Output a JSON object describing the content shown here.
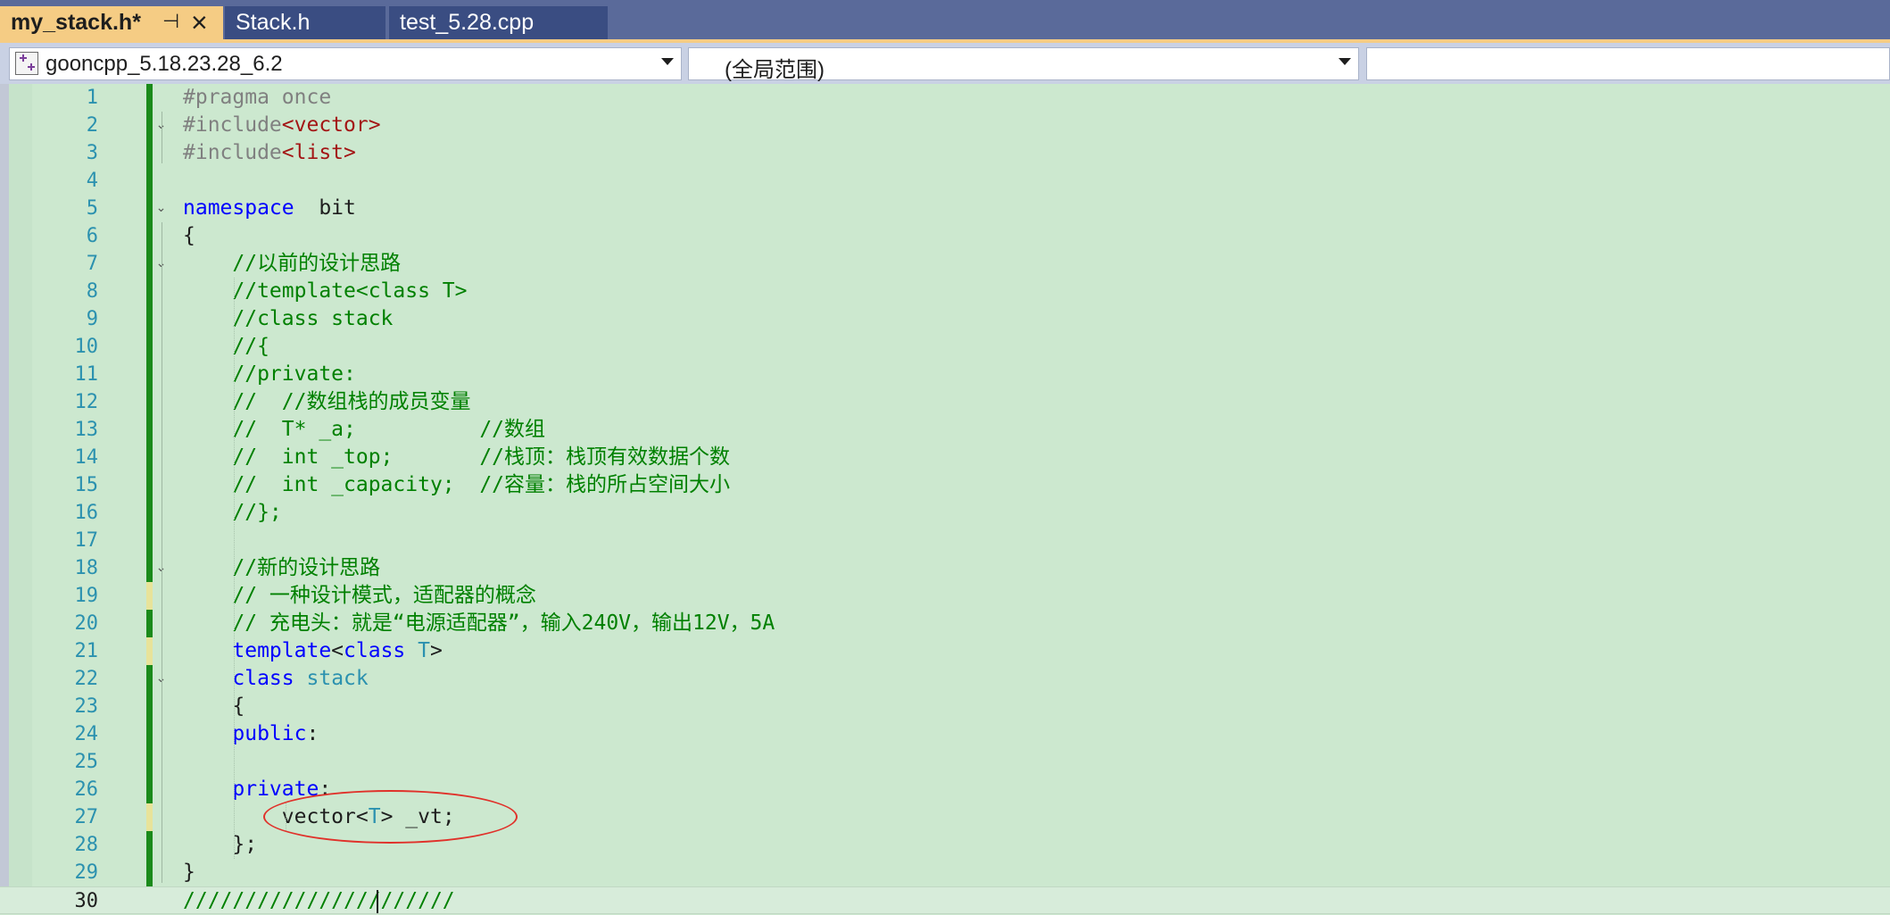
{
  "tabs": [
    {
      "label": "my_stack.h*",
      "active": true,
      "pin_icon": "pin-icon",
      "close_icon": "close-icon"
    },
    {
      "label": "Stack.h",
      "active": false
    },
    {
      "label": "test_5.28.cpp",
      "active": false
    }
  ],
  "navbar": {
    "project": "gooncpp_5.18.23.28_6.2",
    "scope": "(全局范围)",
    "member": ""
  },
  "editor": {
    "current_line": 30,
    "lines": [
      {
        "n": "1",
        "t": [
          [
            "pp",
            "#pragma once"
          ]
        ]
      },
      {
        "n": "2",
        "t": [
          [
            "pp",
            "#include"
          ],
          [
            "str",
            "<vector>"
          ]
        ]
      },
      {
        "n": "3",
        "t": [
          [
            "pp",
            "#include"
          ],
          [
            "str",
            "<list>"
          ]
        ]
      },
      {
        "n": "4",
        "t": []
      },
      {
        "n": "5",
        "t": [
          [
            "kw",
            "namespace"
          ],
          [
            "",
            "  bit"
          ]
        ]
      },
      {
        "n": "6",
        "t": [
          [
            "",
            "{"
          ]
        ]
      },
      {
        "n": "7",
        "t": [
          [
            "cm",
            "    //以前的设计思路"
          ]
        ]
      },
      {
        "n": "8",
        "t": [
          [
            "cm",
            "    //template<class T>"
          ]
        ]
      },
      {
        "n": "9",
        "t": [
          [
            "cm",
            "    //class stack"
          ]
        ]
      },
      {
        "n": "10",
        "t": [
          [
            "cm",
            "    //{"
          ]
        ]
      },
      {
        "n": "11",
        "t": [
          [
            "cm",
            "    //private:"
          ]
        ]
      },
      {
        "n": "12",
        "t": [
          [
            "cm",
            "    //  //数组栈的成员变量"
          ]
        ]
      },
      {
        "n": "13",
        "t": [
          [
            "cm",
            "    //  T* _a;          //数组"
          ]
        ]
      },
      {
        "n": "14",
        "t": [
          [
            "cm",
            "    //  int _top;       //栈顶：栈顶有效数据个数"
          ]
        ]
      },
      {
        "n": "15",
        "t": [
          [
            "cm",
            "    //  int _capacity;  //容量：栈的所占空间大小"
          ]
        ]
      },
      {
        "n": "16",
        "t": [
          [
            "cm",
            "    //};"
          ]
        ]
      },
      {
        "n": "17",
        "t": []
      },
      {
        "n": "18",
        "t": [
          [
            "cm",
            "    //新的设计思路"
          ]
        ]
      },
      {
        "n": "19",
        "t": [
          [
            "cm",
            "    // 一种设计模式，适配器的概念"
          ]
        ]
      },
      {
        "n": "20",
        "t": [
          [
            "cm",
            "    // 充电头：就是“电源适配器”，输入240V，输出12V，5A"
          ]
        ]
      },
      {
        "n": "21",
        "t": [
          [
            "",
            "    "
          ],
          [
            "kw",
            "template"
          ],
          [
            "",
            "<"
          ],
          [
            "kw",
            "class"
          ],
          [
            "",
            " "
          ],
          [
            "ty",
            "T"
          ],
          [
            "",
            ">"
          ]
        ]
      },
      {
        "n": "22",
        "t": [
          [
            "",
            "    "
          ],
          [
            "kw",
            "class"
          ],
          [
            "",
            " "
          ],
          [
            "ty",
            "stack"
          ]
        ]
      },
      {
        "n": "23",
        "t": [
          [
            "",
            "    {"
          ]
        ]
      },
      {
        "n": "24",
        "t": [
          [
            "",
            "    "
          ],
          [
            "kw",
            "public"
          ],
          [
            "",
            ":"
          ]
        ]
      },
      {
        "n": "25",
        "t": []
      },
      {
        "n": "26",
        "t": [
          [
            "",
            "    "
          ],
          [
            "kw",
            "private"
          ],
          [
            "",
            ":"
          ]
        ]
      },
      {
        "n": "27",
        "t": [
          [
            "",
            "        vector<"
          ],
          [
            "ty",
            "T"
          ],
          [
            "",
            "> _vt;"
          ]
        ]
      },
      {
        "n": "28",
        "t": [
          [
            "",
            "    };"
          ]
        ]
      },
      {
        "n": "29",
        "t": [
          [
            "",
            "}"
          ]
        ]
      },
      {
        "n": "30",
        "t": [
          [
            "cm",
            "//////////////////////"
          ]
        ]
      }
    ]
  }
}
